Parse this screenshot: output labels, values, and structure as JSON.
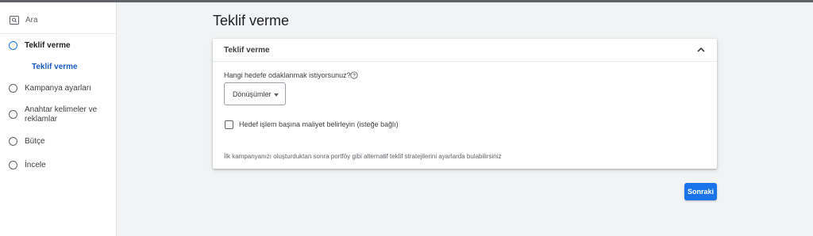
{
  "sidebar": {
    "search_label": "Ara",
    "items": [
      {
        "label": "Teklif verme",
        "active": true
      },
      {
        "label": "Kampanya ayarları",
        "active": false
      },
      {
        "label": "Anahtar kelimeler ve reklamlar",
        "active": false
      },
      {
        "label": "Bütçe",
        "active": false
      },
      {
        "label": "İncele",
        "active": false
      }
    ],
    "sub_item_label": "Teklif verme"
  },
  "main": {
    "page_title": "Teklif verme",
    "card": {
      "title": "Teklif verme",
      "question": "Hangi hedefe odaklanmak istiyorsunuz?",
      "dropdown_value": "Dönüşümler",
      "checkbox_label": "Hedef işlem başına maliyet belirleyin (isteğe bağlı)",
      "checkbox_checked": false,
      "footnote": "İlk kampanyanızı oluşturduktan sonra portföy gibi alternatif teklif stratejilerini ayarlarda bulabilirsiniz"
    },
    "next_button_label": "Sonraki"
  },
  "colors": {
    "accent": "#1a73e8",
    "sidebar_active_text": "#1a5bbf",
    "background": "#f1f3f4"
  },
  "icons": {
    "search": "search-icon",
    "collapse": "chevron-up-icon",
    "help": "help-circle-icon",
    "dropdown": "caret-down-icon"
  }
}
